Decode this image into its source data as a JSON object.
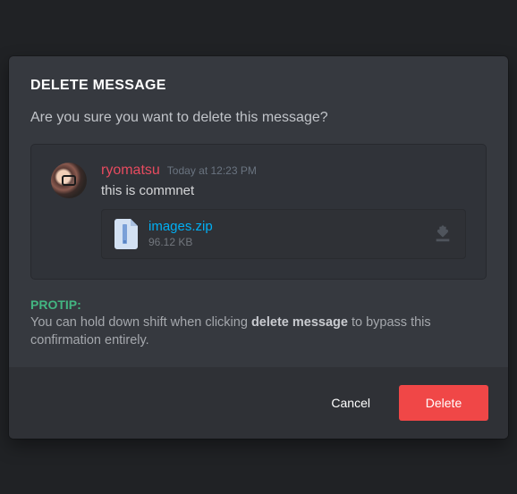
{
  "modal": {
    "title": "DELETE MESSAGE",
    "confirm_text": "Are you sure you want to delete this message?"
  },
  "message": {
    "username": "ryomatsu",
    "timestamp": "Today at 12:23 PM",
    "text": "this is commnet",
    "attachment": {
      "filename": "images.zip",
      "filesize": "96.12 KB"
    }
  },
  "protip": {
    "label": "PROTIP:",
    "text_before": "You can hold down shift when clicking ",
    "text_bold": "delete message",
    "text_after": " to bypass this confirmation entirely."
  },
  "footer": {
    "cancel_label": "Cancel",
    "delete_label": "Delete"
  }
}
